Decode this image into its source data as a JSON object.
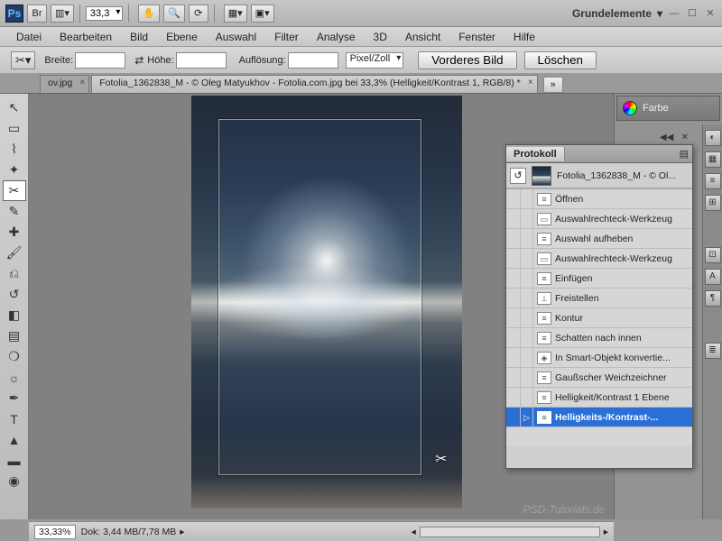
{
  "titlebar": {
    "zoom_value": "33,3",
    "workspace": "Grundelemente"
  },
  "menu": [
    "Datei",
    "Bearbeiten",
    "Bild",
    "Ebene",
    "Auswahl",
    "Filter",
    "Analyse",
    "3D",
    "Ansicht",
    "Fenster",
    "Hilfe"
  ],
  "optbar": {
    "width_label": "Breite:",
    "height_label": "Höhe:",
    "res_label": "Auflösung:",
    "unit": "Pixel/Zoll",
    "front_btn": "Vorderes Bild",
    "clear_btn": "Löschen"
  },
  "tabs": {
    "inactive": "ov.jpg",
    "active": "Fotolia_1362838_M - © Oleg Matyukhov - Fotolia.com.jpg bei 33,3% (Helligkeit/Kontrast 1, RGB/8) *"
  },
  "status": {
    "zoom": "33,33%",
    "doc_label": "Dok:",
    "doc_size": "3,44 MB/7,78 MB"
  },
  "right": {
    "color_label": "Farbe"
  },
  "history": {
    "title": "Protokoll",
    "doc_name": "Fotolia_1362838_M - © Ol...",
    "rows": [
      {
        "icon": "≡",
        "label": "Öffnen"
      },
      {
        "icon": "▭",
        "label": "Auswahlrechteck-Werkzeug"
      },
      {
        "icon": "≡",
        "label": "Auswahl aufheben"
      },
      {
        "icon": "▭",
        "label": "Auswahlrechteck-Werkzeug"
      },
      {
        "icon": "≡",
        "label": "Einfügen"
      },
      {
        "icon": "⟂",
        "label": "Freistellen"
      },
      {
        "icon": "≡",
        "label": "Kontur"
      },
      {
        "icon": "≡",
        "label": "Schatten nach innen"
      },
      {
        "icon": "◈",
        "label": "In Smart-Objekt konvertie..."
      },
      {
        "icon": "≡",
        "label": "Gaußscher Weichzeichner"
      },
      {
        "icon": "≡",
        "label": "Helligkeit/Kontrast 1 Ebene"
      },
      {
        "icon": "≡",
        "label": "Helligkeits-/Kontrast-..."
      }
    ],
    "selected_index": 11
  },
  "watermark": "PSD-Tutorials.de"
}
